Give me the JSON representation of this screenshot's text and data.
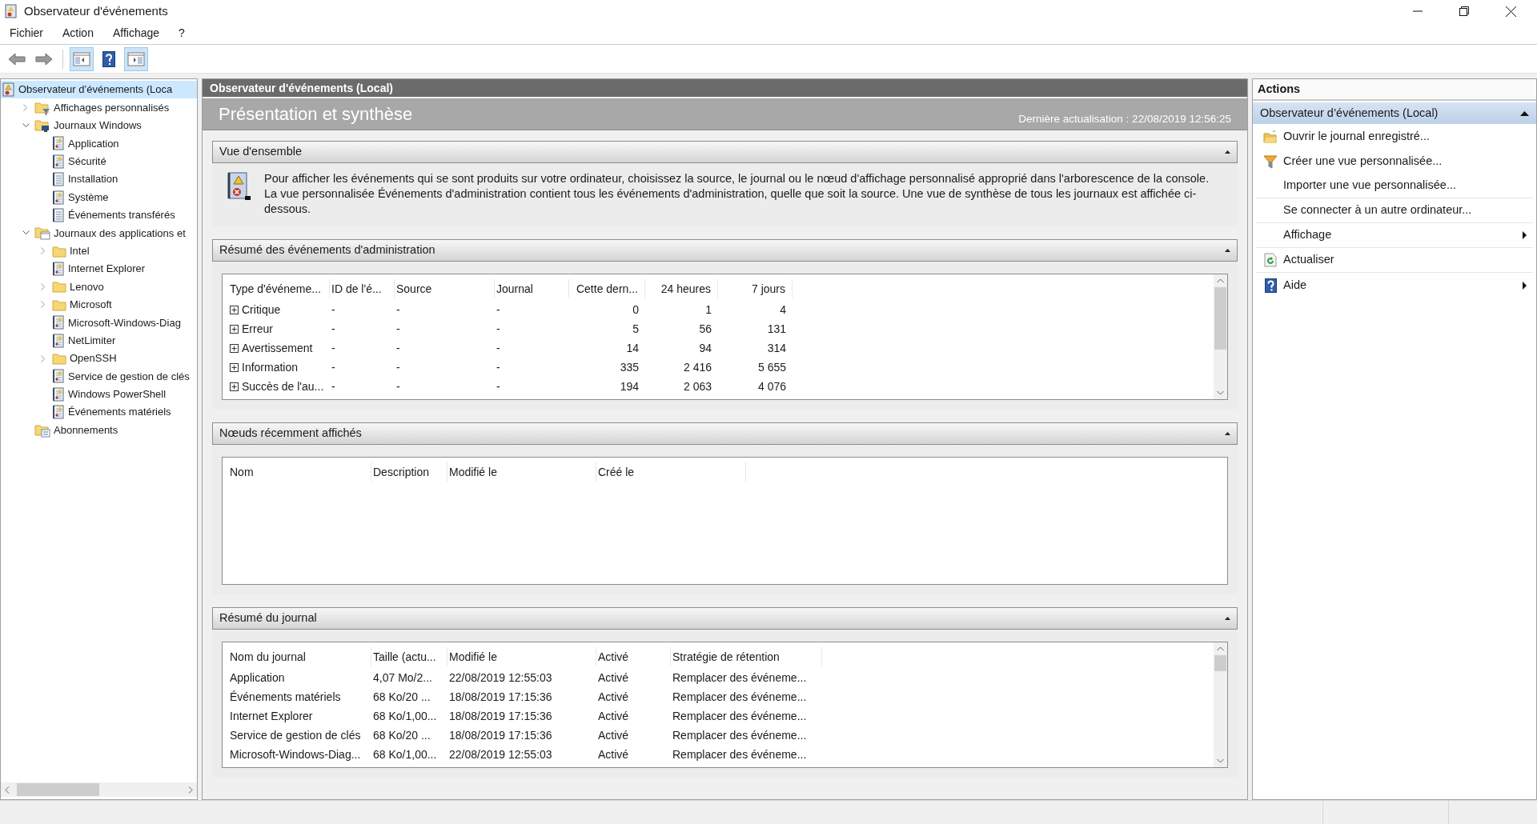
{
  "window": {
    "title": "Observateur d'événements"
  },
  "menu": [
    "Fichier",
    "Action",
    "Affichage",
    "?"
  ],
  "toolbar": [
    {
      "kind": "back",
      "pressed": false
    },
    {
      "kind": "forward",
      "pressed": false
    },
    {
      "kind": "tree-pane",
      "pressed": true
    },
    {
      "kind": "help",
      "pressed": false
    },
    {
      "kind": "action-pane",
      "pressed": true
    }
  ],
  "tree": [
    {
      "label": "Observateur d’événements (Loca",
      "kind": "root",
      "selected": true,
      "children": [
        {
          "label": "Affichages personnalisés",
          "kind": "folder-filter",
          "selected": false,
          "expanded": false
        },
        {
          "label": "Journaux Windows",
          "kind": "folder-pc",
          "selected": false,
          "expanded": true,
          "children": [
            {
              "label": "Application",
              "kind": "log",
              "selected": false
            },
            {
              "label": "Sécurité",
              "kind": "log",
              "selected": false
            },
            {
              "label": "Installation",
              "kind": "log-plain",
              "selected": false
            },
            {
              "label": "Système",
              "kind": "log",
              "selected": false
            },
            {
              "label": "Événements transférés",
              "kind": "log-plain",
              "selected": false
            }
          ]
        },
        {
          "label": "Journaux des applications et",
          "kind": "folder-app",
          "selected": false,
          "expanded": true,
          "children": [
            {
              "label": "Intel",
              "kind": "folder",
              "selected": false,
              "expanded": false
            },
            {
              "label": "Internet Explorer",
              "kind": "log",
              "selected": false
            },
            {
              "label": "Lenovo",
              "kind": "folder",
              "selected": false,
              "expanded": false
            },
            {
              "label": "Microsoft",
              "kind": "folder",
              "selected": false,
              "expanded": false
            },
            {
              "label": "Microsoft-Windows-Diag",
              "kind": "log",
              "selected": false
            },
            {
              "label": "NetLimiter",
              "kind": "log",
              "selected": false
            },
            {
              "label": "OpenSSH",
              "kind": "folder",
              "selected": false,
              "expanded": false
            },
            {
              "label": "Service de gestion de clés",
              "kind": "log",
              "selected": false
            },
            {
              "label": "Windows PowerShell",
              "kind": "log",
              "selected": false
            },
            {
              "label": "Événements matériels",
              "kind": "log",
              "selected": false
            }
          ]
        },
        {
          "label": "Abonnements",
          "kind": "subscriptions",
          "selected": false
        }
      ]
    }
  ],
  "center": {
    "header": "Observateur d'événements (Local)",
    "title": "Présentation et synthèse",
    "last_refresh": "Dernière actualisation : 22/08/2019 12:56:25",
    "sections": [
      {
        "kind": "text",
        "title": "Vue d'ensemble",
        "expanded": true,
        "text": "Pour afficher les événements qui se sont produits sur votre ordinateur, choisissez la source, le journal ou le nœud d'affichage personnalisé approprié dans l'arborescence de la console. La vue personnalisée Événements d'administration contient tous les événements d'administration, quelle que soit la source. Une vue de synthèse de tous les journaux est affichée ci-dessous."
      },
      {
        "kind": "table",
        "title": "Résumé des événements d'administration",
        "expanded": true,
        "columns": [
          {
            "label": "Type d'événeme..."
          },
          {
            "label": "ID de l'é..."
          },
          {
            "label": "Source"
          },
          {
            "label": "Journal"
          },
          {
            "label": "Cette dern..."
          },
          {
            "label": "24 heures"
          },
          {
            "label": "7 jours"
          }
        ],
        "rows": [
          {
            "expanded": false,
            "cells": [
              "Critique",
              "-",
              "-",
              "-",
              "0",
              "1",
              "4"
            ]
          },
          {
            "expanded": false,
            "cells": [
              "Erreur",
              "-",
              "-",
              "-",
              "5",
              "56",
              "131"
            ]
          },
          {
            "expanded": false,
            "cells": [
              "Avertissement",
              "-",
              "-",
              "-",
              "14",
              "94",
              "314"
            ]
          },
          {
            "expanded": false,
            "cells": [
              "Information",
              "-",
              "-",
              "-",
              "335",
              "2 416",
              "5 655"
            ]
          },
          {
            "expanded": false,
            "cells": [
              "Succès de l'au...",
              "-",
              "-",
              "-",
              "194",
              "2 063",
              "4 076"
            ]
          }
        ]
      },
      {
        "kind": "table",
        "title": "Nœuds récemment affichés",
        "expanded": true,
        "columns": [
          {
            "label": "Nom"
          },
          {
            "label": "Description"
          },
          {
            "label": "Modifié le"
          },
          {
            "label": "Créé le"
          }
        ]
      },
      {
        "kind": "table",
        "title": "Résumé du journal",
        "expanded": true,
        "columns": [
          {
            "label": "Nom du journal"
          },
          {
            "label": "Taille (actu..."
          },
          {
            "label": "Modifié le"
          },
          {
            "label": "Activé"
          },
          {
            "label": "Stratégie de rétention"
          }
        ],
        "rows": [
          {
            "cells": [
              "Application",
              "4,07 Mo/2...",
              "22/08/2019 12:55:03",
              "Activé",
              "Remplacer des événeme..."
            ]
          },
          {
            "cells": [
              "Événements matériels",
              "68 Ko/20 ...",
              "18/08/2019 17:15:36",
              "Activé",
              "Remplacer des événeme..."
            ]
          },
          {
            "cells": [
              "Internet Explorer",
              "68 Ko/1,00...",
              "18/08/2019 17:15:36",
              "Activé",
              "Remplacer des événeme..."
            ]
          },
          {
            "cells": [
              "Service de gestion de clés",
              "68 Ko/20 ...",
              "18/08/2019 17:15:36",
              "Activé",
              "Remplacer des événeme..."
            ]
          },
          {
            "cells": [
              "Microsoft-Windows-Diag...",
              "68 Ko/1,00...",
              "22/08/2019 12:55:03",
              "Activé",
              "Remplacer des événeme..."
            ]
          }
        ]
      }
    ]
  },
  "actions": {
    "title": "Actions",
    "group": {
      "title": "Observateur d’événements (Local)",
      "expanded": true,
      "items": [
        {
          "label": "Ouvrir le journal enregistré...",
          "kind": "open",
          "submenu": false,
          "separator": false
        },
        {
          "label": "Créer une vue personnalisée...",
          "kind": "filter",
          "submenu": false,
          "separator": false
        },
        {
          "label": "Importer une vue personnalisée...",
          "kind": "plain",
          "submenu": false,
          "separator": true
        },
        {
          "label": "Se connecter à un autre ordinateur...",
          "kind": "plain",
          "submenu": false,
          "separator": true
        },
        {
          "label": "Affichage",
          "kind": "plain",
          "submenu": true,
          "separator": true
        },
        {
          "label": "Actualiser",
          "kind": "refresh",
          "submenu": false,
          "separator": true
        },
        {
          "label": "Aide",
          "kind": "help",
          "submenu": true,
          "separator": false
        }
      ]
    }
  }
}
